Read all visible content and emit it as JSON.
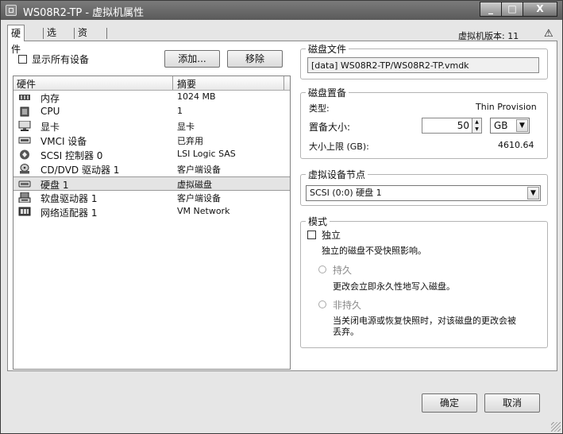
{
  "window": {
    "title": "WS08R2-TP - 虚拟机属性",
    "controls": {
      "minimize": "_",
      "maximize": "□",
      "close": "X"
    }
  },
  "tabs": [
    {
      "label": "硬件",
      "active": true
    },
    {
      "label": "选项",
      "active": false
    },
    {
      "label": "资源",
      "active": false
    }
  ],
  "version_label": "虚拟机版本: 11",
  "help_icon": "⚠",
  "left": {
    "show_all_devices": "显示所有设备",
    "add_button": "添加...",
    "remove_button": "移除",
    "list_headers": {
      "hardware": "硬件",
      "summary": "摘要"
    },
    "devices": [
      {
        "name": "内存",
        "summary": "1024 MB",
        "icon": "memory-icon",
        "selected": false
      },
      {
        "name": "CPU",
        "summary": "1",
        "icon": "cpu-icon",
        "selected": false
      },
      {
        "name": "显卡",
        "summary": "显卡",
        "icon": "display-icon",
        "selected": false
      },
      {
        "name": "VMCI 设备",
        "summary": "已弃用",
        "icon": "vmci-icon",
        "selected": false
      },
      {
        "name": "SCSI 控制器 0",
        "summary": "LSI Logic SAS",
        "icon": "scsi-icon",
        "selected": false
      },
      {
        "name": "CD/DVD 驱动器 1",
        "summary": "客户端设备",
        "icon": "cdrom-icon",
        "selected": false
      },
      {
        "name": "硬盘 1",
        "summary": "虚拟磁盘",
        "icon": "harddisk-icon",
        "selected": true
      },
      {
        "name": "软盘驱动器 1",
        "summary": "客户端设备",
        "icon": "floppy-icon",
        "selected": false
      },
      {
        "name": "网络适配器 1",
        "summary": "VM Network",
        "icon": "network-icon",
        "selected": false
      }
    ]
  },
  "disk_file": {
    "title": "磁盘文件",
    "path": "[data] WS08R2-TP/WS08R2-TP.vmdk"
  },
  "provisioning": {
    "title": "磁盘置备",
    "type_label": "类型:",
    "type_value": "Thin Provision",
    "size_label": "置备大小:",
    "size_value": "50",
    "size_unit": "GB",
    "max_label": "大小上限 (GB):",
    "max_value": "4610.64"
  },
  "device_node": {
    "title": "虚拟设备节点",
    "value": "SCSI (0:0) 硬盘 1"
  },
  "mode": {
    "title": "模式",
    "independent": "独立",
    "independent_desc": "独立的磁盘不受快照影响。",
    "persistent": "持久",
    "persistent_desc": "更改会立即永久性地写入磁盘。",
    "nonpersistent": "非持久",
    "nonpersistent_desc_1": "当关闭电源或恢复快照时，对该磁盘的更改会被",
    "nonpersistent_desc_2": "丢弃。"
  },
  "footer": {
    "ok_button": "确定",
    "cancel_button": "取消"
  }
}
